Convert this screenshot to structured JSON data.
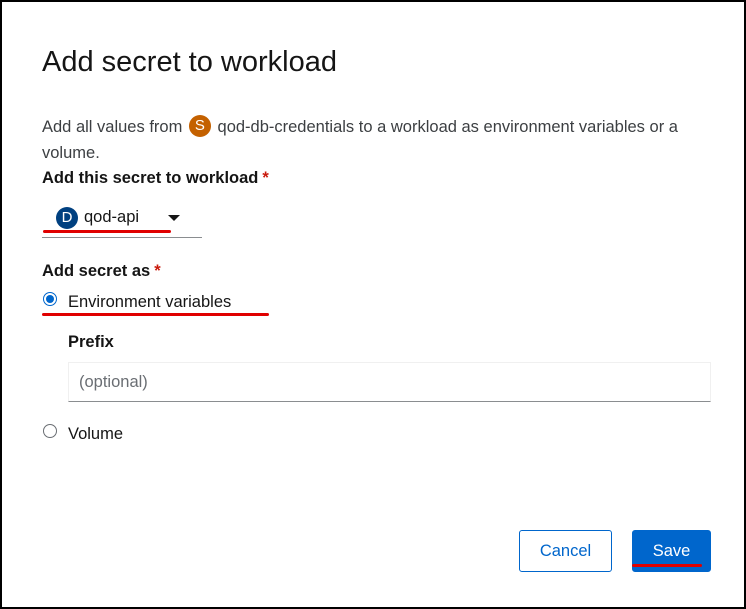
{
  "modal": {
    "title": "Add secret to workload",
    "description": {
      "prefix": "Add all values from",
      "secret_badge": "S",
      "secret_name": "qod-db-credentials",
      "suffix": "to a workload as environment variables or a volume."
    },
    "workload_field": {
      "label": "Add this secret to workload",
      "required_mark": "*",
      "selected_badge": "D",
      "selected_value": "qod-api"
    },
    "add_as_field": {
      "label": "Add secret as",
      "required_mark": "*",
      "options": [
        {
          "label": "Environment variables",
          "checked": true
        },
        {
          "label": "Volume",
          "checked": false
        }
      ]
    },
    "prefix_field": {
      "label": "Prefix",
      "value": "",
      "placeholder": "(optional)"
    },
    "buttons": {
      "cancel_label": "Cancel",
      "save_label": "Save"
    }
  },
  "colors": {
    "primary": "#0066cc",
    "secret_badge": "#c46100",
    "deployment_badge": "#004080",
    "required": "#c9190b",
    "annotation_underline": "#e00000"
  },
  "icons": {
    "secret_badge": "secret-badge-icon",
    "deployment_badge": "deployment-badge-icon",
    "dropdown": "caret-down-icon"
  }
}
